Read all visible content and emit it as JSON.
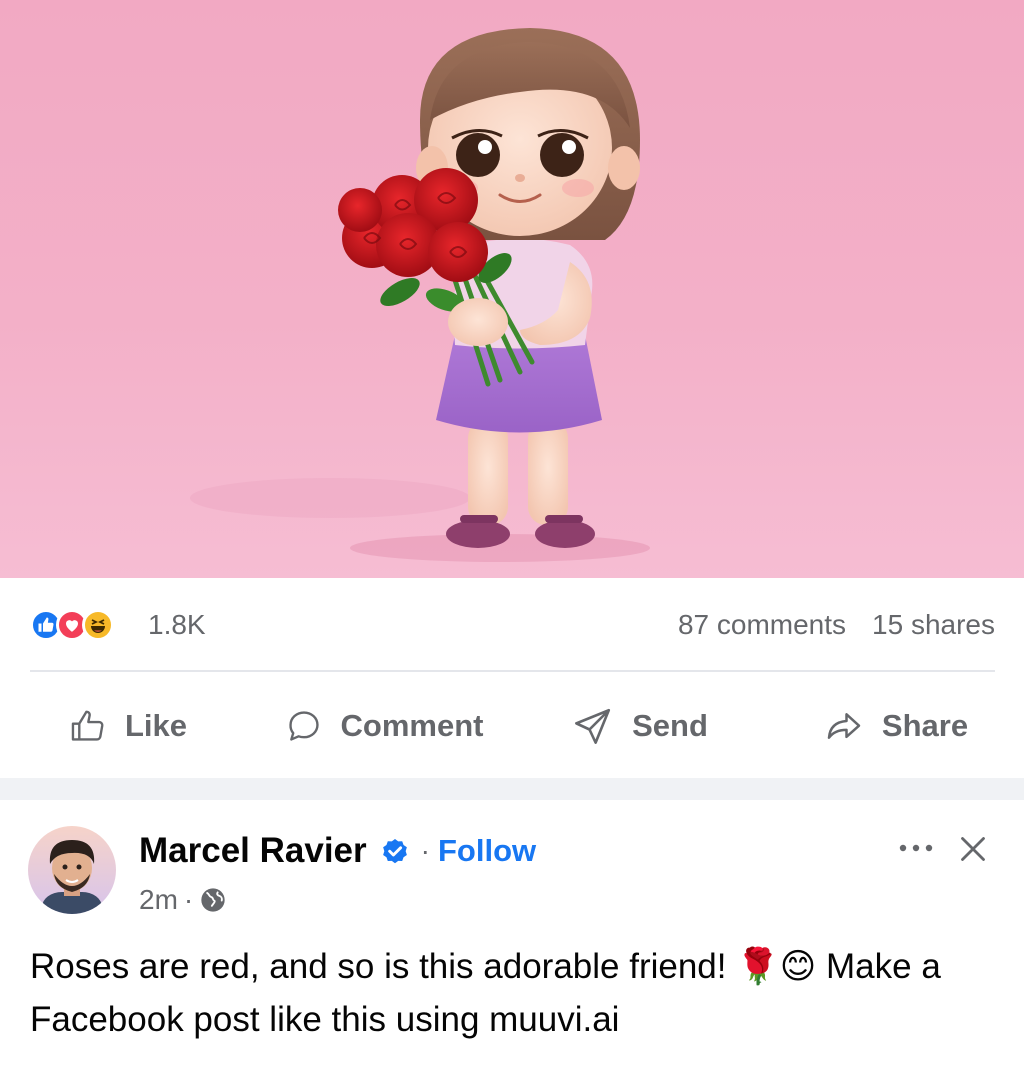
{
  "hero_image": {
    "alt": "3D cartoon girl holding a bouquet of red roses on a pink background",
    "background_color": "#f3b0c8"
  },
  "reactions": {
    "icons": [
      "like-icon",
      "love-icon",
      "haha-icon"
    ],
    "count": "1.8K"
  },
  "stats": {
    "comments": "87 comments",
    "shares": "15 shares"
  },
  "actions": [
    {
      "label": "Like",
      "icon": "thumbs-up-icon"
    },
    {
      "label": "Comment",
      "icon": "comment-bubble-icon"
    },
    {
      "label": "Send",
      "icon": "paper-plane-icon"
    },
    {
      "label": "Share",
      "icon": "share-arrow-icon"
    }
  ],
  "post": {
    "author": "Marcel Ravier",
    "verified": true,
    "follow_label": "Follow",
    "time": "2m",
    "privacy_icon": "globe-icon",
    "text": "Roses are red, and so is this adorable friend! 🌹😊 Make a Facebook post like this using muuvi.ai"
  },
  "colors": {
    "brand_blue": "#1877f2",
    "muted_text": "#65676b",
    "divider": "#e4e6eb"
  }
}
